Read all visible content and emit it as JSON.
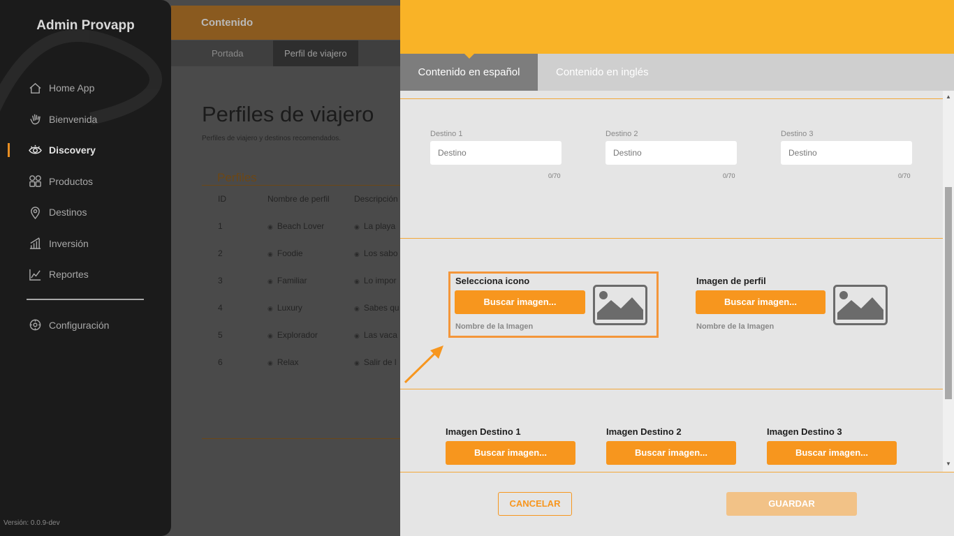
{
  "sidebar": {
    "brand": "Admin Provapp",
    "items": [
      {
        "label": "Home App",
        "icon": "home-icon"
      },
      {
        "label": "Bienvenida",
        "icon": "wave-hand-icon"
      },
      {
        "label": "Discovery",
        "icon": "eye-icon",
        "active": true
      },
      {
        "label": "Productos",
        "icon": "grid-icon"
      },
      {
        "label": "Destinos",
        "icon": "location-pin-icon"
      },
      {
        "label": "Inversión",
        "icon": "bar-chart-icon"
      },
      {
        "label": "Reportes",
        "icon": "line-chart-icon"
      }
    ],
    "settings": {
      "label": "Configuración",
      "icon": "gear-icon"
    },
    "version": "Versión: 0.0.9-dev"
  },
  "background": {
    "header": "Contenido",
    "subnav": [
      "Portada",
      "Perfil de viajero"
    ],
    "title": "Perfiles de viajero",
    "subtitle": "Perfiles de viajero y destinos recomendados.",
    "section": "Perfiles",
    "table": {
      "headers": [
        "ID",
        "Nombre de perfil",
        "Descripción"
      ],
      "rows": [
        [
          "1",
          "Beach Lover",
          "La playa"
        ],
        [
          "2",
          "Foodie",
          "Los sabo"
        ],
        [
          "3",
          "Familiar",
          "Lo impor"
        ],
        [
          "4",
          "Luxury",
          "Sabes qu"
        ],
        [
          "5",
          "Explorador",
          "Las vaca"
        ],
        [
          "6",
          "Relax",
          "Salir de l"
        ]
      ]
    }
  },
  "drawer": {
    "tabs": {
      "spanish": "Contenido en español",
      "english": "Contenido en inglés"
    },
    "destinos": [
      {
        "label": "Destino 1",
        "placeholder": "Destino",
        "counter": "0/70"
      },
      {
        "label": "Destino 2",
        "placeholder": "Destino",
        "counter": "0/70"
      },
      {
        "label": "Destino 3",
        "placeholder": "Destino",
        "counter": "0/70"
      }
    ],
    "icono": {
      "label": "Selecciona icono",
      "button": "Buscar imagen...",
      "name": "Nombre de la Imagen"
    },
    "perfil": {
      "label": "Imagen de perfil",
      "button": "Buscar imagen...",
      "name": "Nombre de la Imagen"
    },
    "imagenes_destino": [
      {
        "label": "Imagen Destino 1",
        "button": "Buscar imagen..."
      },
      {
        "label": "Imagen Destino 2",
        "button": "Buscar imagen..."
      },
      {
        "label": "Imagen Destino 3",
        "button": "Buscar imagen..."
      }
    ],
    "footer": {
      "cancel": "CANCELAR",
      "save": "GUARDAR"
    }
  },
  "colors": {
    "accent": "#f7961e",
    "drawer_header": "#f9b327",
    "sidebar_bg": "#1b1b1b",
    "save_disabled": "#f2c287"
  }
}
